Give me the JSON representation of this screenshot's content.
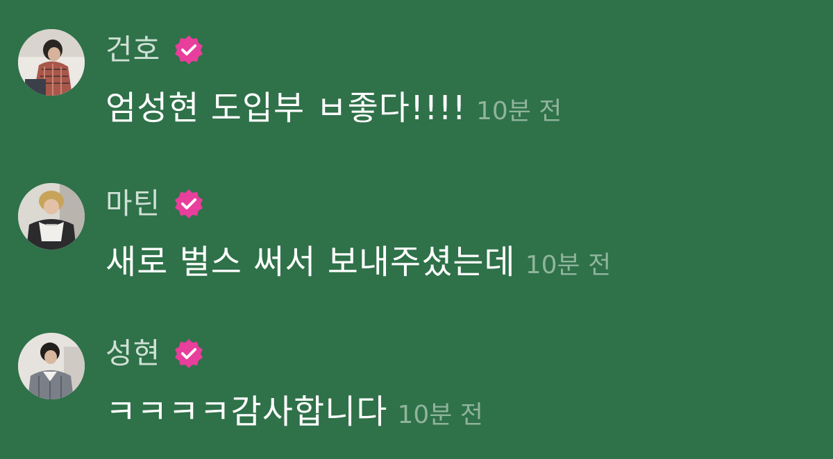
{
  "comments": [
    {
      "username": "건호",
      "text": "엄성현 도입부 ㅂ좋다!!!!",
      "time": "10분 전",
      "avatar_icon": "profile-photo",
      "verified_icon": "verified-badge-icon"
    },
    {
      "username": "마틴",
      "text": "새로 벌스 써서 보내주셨는데",
      "time": "10분 전",
      "avatar_icon": "profile-photo",
      "verified_icon": "verified-badge-icon"
    },
    {
      "username": "성현",
      "text": "ㅋㅋㅋㅋ감사합니다",
      "time": "10분 전",
      "avatar_icon": "profile-photo",
      "verified_icon": "verified-badge-icon"
    }
  ],
  "colors": {
    "background": "#2f7149",
    "username": "#cfe0d5",
    "message": "#ffffff",
    "timestamp": "#8fb49c",
    "verified_badge": "#e83e9c"
  }
}
